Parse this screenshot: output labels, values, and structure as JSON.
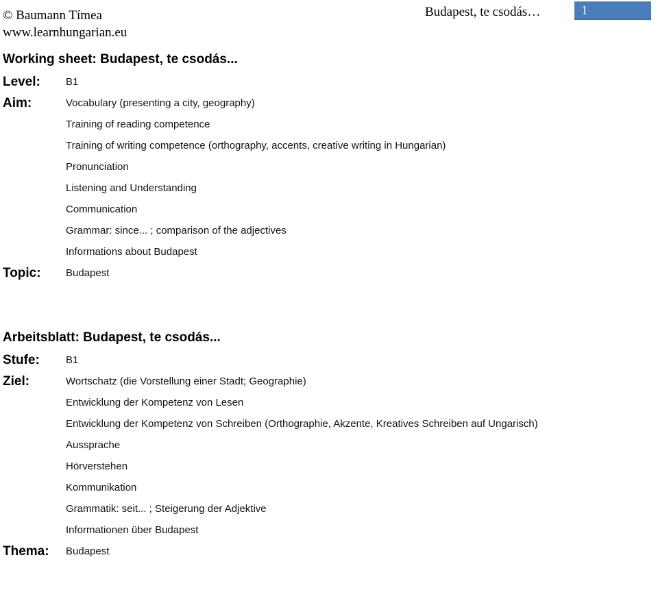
{
  "header": {
    "copyright": "© Baumann Tímea",
    "website": "www.learnhungarian.eu",
    "document_title": "Budapest, te csodás…",
    "page_number": "1",
    "accent_color": "#4A7EBB"
  },
  "sections": [
    {
      "id": "english",
      "title": "Working sheet: Budapest, te csodás...",
      "rows": [
        {
          "label": "Level:",
          "values": [
            "B1"
          ]
        },
        {
          "label": "Aim:",
          "values": [
            "Vocabulary (presenting a city, geography)",
            "Training of reading competence",
            "Training of writing competence (orthography, accents, creative writing in Hungarian)",
            "Pronunciation",
            "Listening and Understanding",
            "Communication",
            "Grammar: since... ; comparison of the adjectives",
            "Informations about Budapest"
          ]
        },
        {
          "label": "Topic:",
          "values": [
            "Budapest"
          ]
        }
      ]
    },
    {
      "id": "german",
      "title": "Arbeitsblatt: Budapest, te csodás...",
      "rows": [
        {
          "label": "Stufe:",
          "values": [
            "B1"
          ]
        },
        {
          "label": "Ziel:",
          "values": [
            "Wortschatz (die Vorstellung einer Stadt; Geographie)",
            "Entwicklung der Kompetenz von Lesen",
            "Entwicklung der Kompetenz von Schreiben (Orthographie, Akzente, Kreatives Schreiben auf Ungarisch)",
            "Aussprache",
            "Hörverstehen",
            "Kommunikation",
            "Grammatik: seit... ; Steigerung der Adjektive",
            "Informationen über Budapest"
          ]
        },
        {
          "label": "Thema:",
          "values": [
            "Budapest"
          ]
        }
      ]
    }
  ]
}
